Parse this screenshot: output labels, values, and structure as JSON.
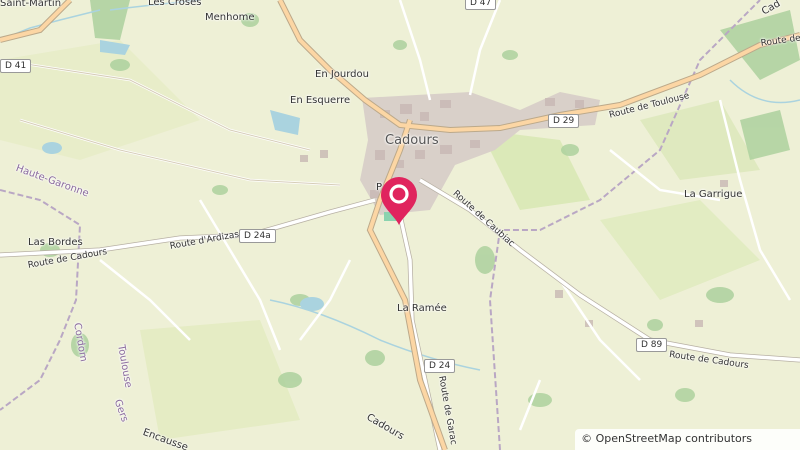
{
  "map": {
    "places": {
      "saint_martin": "Saint-Martin",
      "les_croses": "Les Croses",
      "menhome": "Menhome",
      "en_jourdou": "En Jourdou",
      "en_esquerre": "En Esquerre",
      "cadours": "Cadours",
      "la_garrigue": "La Garrigue",
      "las_bordes": "Las Bordes",
      "la_ramee": "La Ramée",
      "encausse": "Encausse",
      "cadours_south": "Cadours",
      "partial_p": "P",
      "partial_cad": "Cad"
    },
    "regions": {
      "haute_garonne": "Haute-Garonne",
      "gers": "Gers",
      "toulouse": "Toulouse",
      "cordom": "Cordom"
    },
    "roads": {
      "route_de_toulouse": "Route de Toulouse",
      "route_de_toulouse_east": "Route de",
      "route_de_caubiac": "Route de Caubiac",
      "route_dardizas": "Route d'Ardizas",
      "route_de_cadours_west": "Route de Cadours",
      "route_de_cadours_east": "Route de Cadours",
      "route_de_garac": "Route de Garac"
    },
    "shields": {
      "d41": "D 41",
      "d47": "D 47",
      "d29": "D 29",
      "d24a": "D 24a",
      "d24": "D 24",
      "d89": "D 89"
    },
    "attribution": "© OpenStreetMap contributors",
    "colors": {
      "land": "#eef0d6",
      "forest": "#add19e",
      "water": "#aad3df",
      "primary_road": "#fcd6a4",
      "road_outline": "#bca98a",
      "built_up": "#d9d0c9",
      "marker": "#e0245e"
    },
    "marker_icon": "map-pin-icon"
  }
}
